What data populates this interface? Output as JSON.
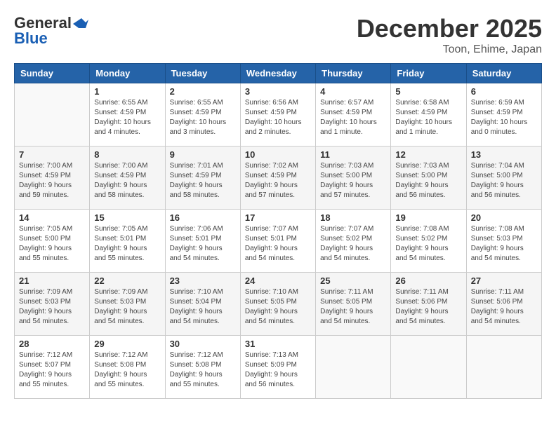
{
  "logo": {
    "line1": "General",
    "line2": "Blue",
    "icon": "▶"
  },
  "title": "December 2025",
  "location": "Toon, Ehime, Japan",
  "weekdays": [
    "Sunday",
    "Monday",
    "Tuesday",
    "Wednesday",
    "Thursday",
    "Friday",
    "Saturday"
  ],
  "weeks": [
    [
      {
        "day": "",
        "info": ""
      },
      {
        "day": "1",
        "info": "Sunrise: 6:55 AM\nSunset: 4:59 PM\nDaylight: 10 hours\nand 4 minutes."
      },
      {
        "day": "2",
        "info": "Sunrise: 6:55 AM\nSunset: 4:59 PM\nDaylight: 10 hours\nand 3 minutes."
      },
      {
        "day": "3",
        "info": "Sunrise: 6:56 AM\nSunset: 4:59 PM\nDaylight: 10 hours\nand 2 minutes."
      },
      {
        "day": "4",
        "info": "Sunrise: 6:57 AM\nSunset: 4:59 PM\nDaylight: 10 hours\nand 1 minute."
      },
      {
        "day": "5",
        "info": "Sunrise: 6:58 AM\nSunset: 4:59 PM\nDaylight: 10 hours\nand 1 minute."
      },
      {
        "day": "6",
        "info": "Sunrise: 6:59 AM\nSunset: 4:59 PM\nDaylight: 10 hours\nand 0 minutes."
      }
    ],
    [
      {
        "day": "7",
        "info": "Sunrise: 7:00 AM\nSunset: 4:59 PM\nDaylight: 9 hours\nand 59 minutes."
      },
      {
        "day": "8",
        "info": "Sunrise: 7:00 AM\nSunset: 4:59 PM\nDaylight: 9 hours\nand 58 minutes."
      },
      {
        "day": "9",
        "info": "Sunrise: 7:01 AM\nSunset: 4:59 PM\nDaylight: 9 hours\nand 58 minutes."
      },
      {
        "day": "10",
        "info": "Sunrise: 7:02 AM\nSunset: 4:59 PM\nDaylight: 9 hours\nand 57 minutes."
      },
      {
        "day": "11",
        "info": "Sunrise: 7:03 AM\nSunset: 5:00 PM\nDaylight: 9 hours\nand 57 minutes."
      },
      {
        "day": "12",
        "info": "Sunrise: 7:03 AM\nSunset: 5:00 PM\nDaylight: 9 hours\nand 56 minutes."
      },
      {
        "day": "13",
        "info": "Sunrise: 7:04 AM\nSunset: 5:00 PM\nDaylight: 9 hours\nand 56 minutes."
      }
    ],
    [
      {
        "day": "14",
        "info": "Sunrise: 7:05 AM\nSunset: 5:00 PM\nDaylight: 9 hours\nand 55 minutes."
      },
      {
        "day": "15",
        "info": "Sunrise: 7:05 AM\nSunset: 5:01 PM\nDaylight: 9 hours\nand 55 minutes."
      },
      {
        "day": "16",
        "info": "Sunrise: 7:06 AM\nSunset: 5:01 PM\nDaylight: 9 hours\nand 54 minutes."
      },
      {
        "day": "17",
        "info": "Sunrise: 7:07 AM\nSunset: 5:01 PM\nDaylight: 9 hours\nand 54 minutes."
      },
      {
        "day": "18",
        "info": "Sunrise: 7:07 AM\nSunset: 5:02 PM\nDaylight: 9 hours\nand 54 minutes."
      },
      {
        "day": "19",
        "info": "Sunrise: 7:08 AM\nSunset: 5:02 PM\nDaylight: 9 hours\nand 54 minutes."
      },
      {
        "day": "20",
        "info": "Sunrise: 7:08 AM\nSunset: 5:03 PM\nDaylight: 9 hours\nand 54 minutes."
      }
    ],
    [
      {
        "day": "21",
        "info": "Sunrise: 7:09 AM\nSunset: 5:03 PM\nDaylight: 9 hours\nand 54 minutes."
      },
      {
        "day": "22",
        "info": "Sunrise: 7:09 AM\nSunset: 5:03 PM\nDaylight: 9 hours\nand 54 minutes."
      },
      {
        "day": "23",
        "info": "Sunrise: 7:10 AM\nSunset: 5:04 PM\nDaylight: 9 hours\nand 54 minutes."
      },
      {
        "day": "24",
        "info": "Sunrise: 7:10 AM\nSunset: 5:05 PM\nDaylight: 9 hours\nand 54 minutes."
      },
      {
        "day": "25",
        "info": "Sunrise: 7:11 AM\nSunset: 5:05 PM\nDaylight: 9 hours\nand 54 minutes."
      },
      {
        "day": "26",
        "info": "Sunrise: 7:11 AM\nSunset: 5:06 PM\nDaylight: 9 hours\nand 54 minutes."
      },
      {
        "day": "27",
        "info": "Sunrise: 7:11 AM\nSunset: 5:06 PM\nDaylight: 9 hours\nand 54 minutes."
      }
    ],
    [
      {
        "day": "28",
        "info": "Sunrise: 7:12 AM\nSunset: 5:07 PM\nDaylight: 9 hours\nand 55 minutes."
      },
      {
        "day": "29",
        "info": "Sunrise: 7:12 AM\nSunset: 5:08 PM\nDaylight: 9 hours\nand 55 minutes."
      },
      {
        "day": "30",
        "info": "Sunrise: 7:12 AM\nSunset: 5:08 PM\nDaylight: 9 hours\nand 55 minutes."
      },
      {
        "day": "31",
        "info": "Sunrise: 7:13 AM\nSunset: 5:09 PM\nDaylight: 9 hours\nand 56 minutes."
      },
      {
        "day": "",
        "info": ""
      },
      {
        "day": "",
        "info": ""
      },
      {
        "day": "",
        "info": ""
      }
    ]
  ]
}
